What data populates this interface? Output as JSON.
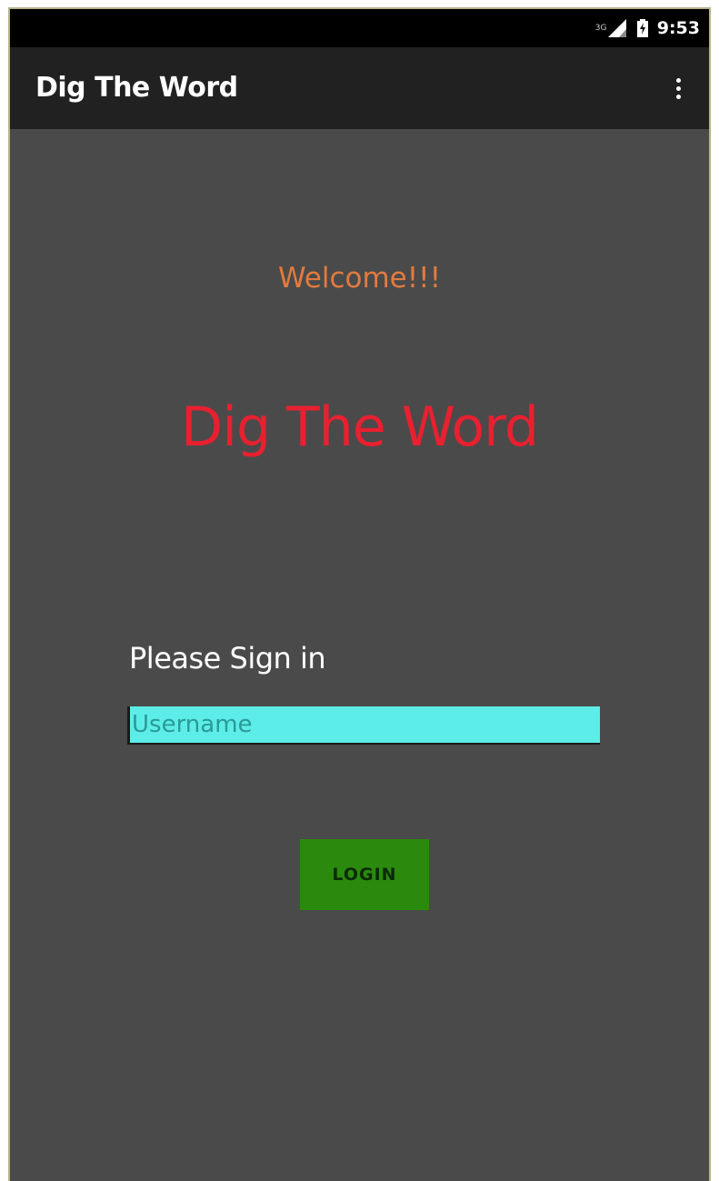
{
  "status_bar": {
    "network": "3G",
    "time": "9:53",
    "icons": [
      "signal-icon",
      "battery-charging-icon"
    ]
  },
  "app_bar": {
    "title": "Dig The Word",
    "overflow_icon": "more-vert-icon"
  },
  "main": {
    "welcome": "Welcome!!!",
    "title": "Dig The Word",
    "sign_in_label": "Please Sign in",
    "username": {
      "value": "",
      "placeholder": "Username"
    },
    "login_label": "LOGIN"
  },
  "colors": {
    "background": "#4a4a4a",
    "app_bar": "#212121",
    "welcome_text": "#e27a3e",
    "title_text": "#e8202f",
    "input_bg": "#5dede8",
    "button_bg": "#2b8a0e"
  }
}
